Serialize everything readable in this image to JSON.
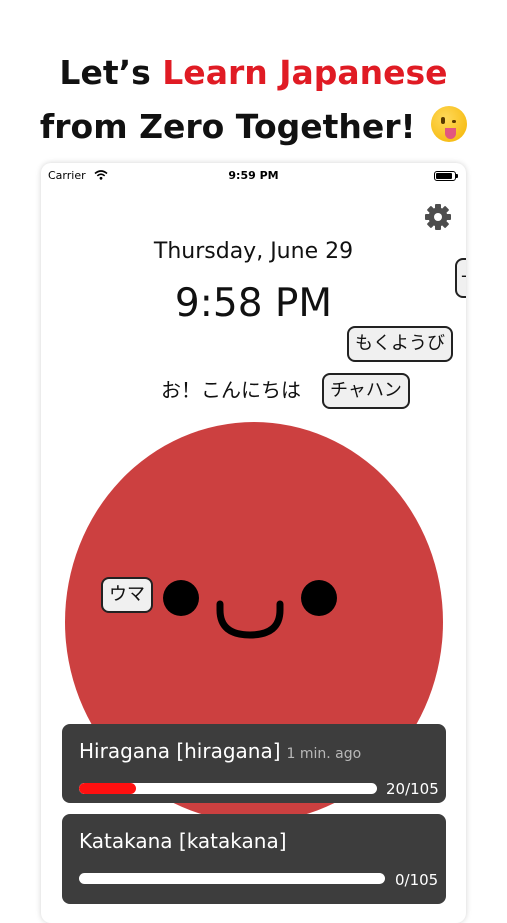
{
  "headline": {
    "part1": "Let’s ",
    "accent": "Learn Japanese",
    "line2": "from Zero Together!",
    "accent_color": "#e01b24"
  },
  "status_bar": {
    "carrier": "Carrier",
    "time": "9:59 PM"
  },
  "settings_icon": "gear-icon",
  "date": "Thursday, June 29",
  "time": "9:58 PM",
  "greeting": "お！こんにちは",
  "bubbles": {
    "weekday": "もくようび",
    "food": "チャハン",
    "horse": "ウマ",
    "edge": "-"
  },
  "mascot_color": "#cc4040",
  "cards": [
    {
      "title": "Hiragana [hiragana]",
      "ago": "1 min. ago",
      "count": "20/105",
      "progress": 0.19
    },
    {
      "title": "Katakana [katakana]",
      "ago": "",
      "count": "0/105",
      "progress": 0
    }
  ]
}
